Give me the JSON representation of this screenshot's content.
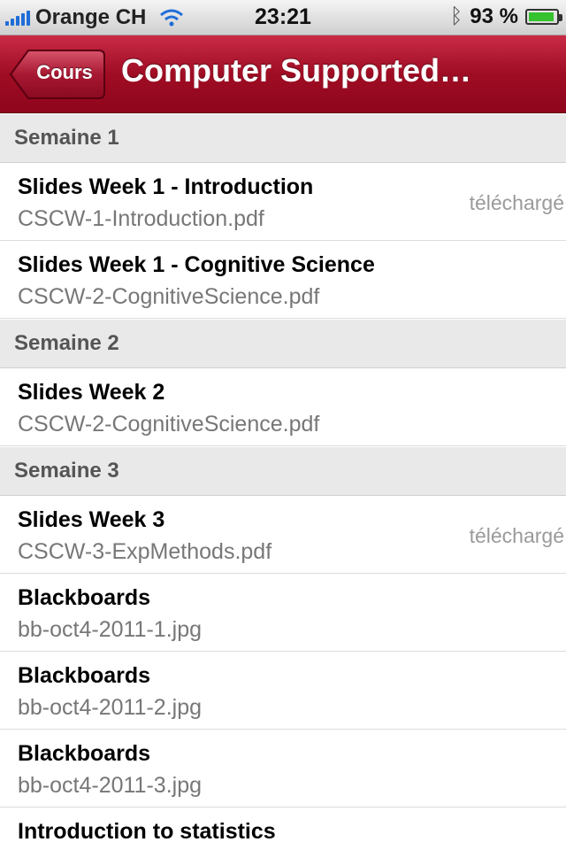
{
  "status_bar": {
    "carrier": "Orange CH",
    "time": "23:21",
    "battery": "93 %",
    "battery_level": 0.93,
    "icons": [
      "signal-icon",
      "wifi-icon",
      "bluetooth-icon",
      "battery-icon"
    ]
  },
  "nav": {
    "back_label": "Cours",
    "title": "Computer Supported…",
    "colors": {
      "bar": "#a0102a",
      "text": "#ffffff"
    }
  },
  "sections": [
    {
      "title": "Semaine 1",
      "items": [
        {
          "name": "Slides Week 1 - Introduction",
          "file": "CSCW-1-Introduction.pdf",
          "status": "téléchargé"
        },
        {
          "name": "Slides Week 1 - Cognitive Science",
          "file": "CSCW-2-CognitiveScience.pdf",
          "status": ""
        }
      ]
    },
    {
      "title": "Semaine 2",
      "items": [
        {
          "name": "Slides Week 2",
          "file": "CSCW-2-CognitiveScience.pdf",
          "status": ""
        }
      ]
    },
    {
      "title": "Semaine 3",
      "items": [
        {
          "name": "Slides Week 3",
          "file": "CSCW-3-ExpMethods.pdf",
          "status": "téléchargé"
        },
        {
          "name": "Blackboards",
          "file": "bb-oct4-2011-1.jpg",
          "status": ""
        },
        {
          "name": "Blackboards",
          "file": "bb-oct4-2011-2.jpg",
          "status": ""
        },
        {
          "name": "Blackboards",
          "file": "bb-oct4-2011-3.jpg",
          "status": ""
        },
        {
          "name": "Introduction to statistics",
          "file": "",
          "status": ""
        }
      ]
    }
  ]
}
